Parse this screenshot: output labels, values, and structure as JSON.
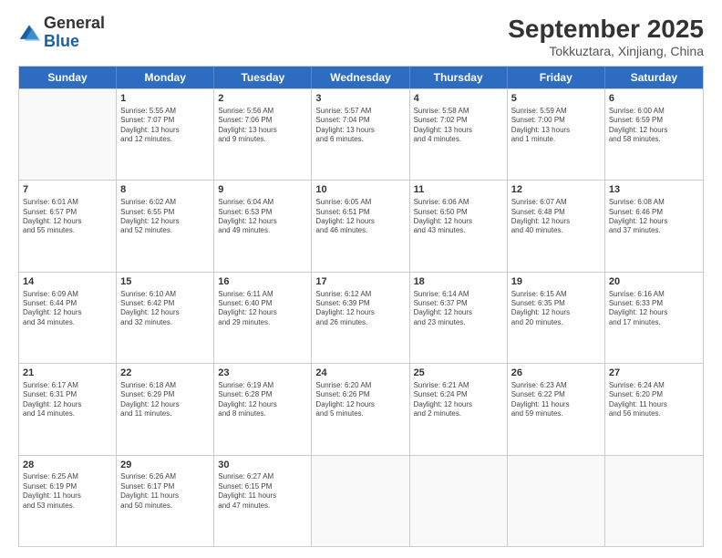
{
  "logo": {
    "general": "General",
    "blue": "Blue"
  },
  "header": {
    "month": "September 2025",
    "location": "Tokkuztara, Xinjiang, China"
  },
  "days": [
    "Sunday",
    "Monday",
    "Tuesday",
    "Wednesday",
    "Thursday",
    "Friday",
    "Saturday"
  ],
  "rows": [
    [
      {
        "day": "",
        "content": ""
      },
      {
        "day": "1",
        "content": "Sunrise: 5:55 AM\nSunset: 7:07 PM\nDaylight: 13 hours\nand 12 minutes."
      },
      {
        "day": "2",
        "content": "Sunrise: 5:56 AM\nSunset: 7:06 PM\nDaylight: 13 hours\nand 9 minutes."
      },
      {
        "day": "3",
        "content": "Sunrise: 5:57 AM\nSunset: 7:04 PM\nDaylight: 13 hours\nand 6 minutes."
      },
      {
        "day": "4",
        "content": "Sunrise: 5:58 AM\nSunset: 7:02 PM\nDaylight: 13 hours\nand 4 minutes."
      },
      {
        "day": "5",
        "content": "Sunrise: 5:59 AM\nSunset: 7:00 PM\nDaylight: 13 hours\nand 1 minute."
      },
      {
        "day": "6",
        "content": "Sunrise: 6:00 AM\nSunset: 6:59 PM\nDaylight: 12 hours\nand 58 minutes."
      }
    ],
    [
      {
        "day": "7",
        "content": "Sunrise: 6:01 AM\nSunset: 6:57 PM\nDaylight: 12 hours\nand 55 minutes."
      },
      {
        "day": "8",
        "content": "Sunrise: 6:02 AM\nSunset: 6:55 PM\nDaylight: 12 hours\nand 52 minutes."
      },
      {
        "day": "9",
        "content": "Sunrise: 6:04 AM\nSunset: 6:53 PM\nDaylight: 12 hours\nand 49 minutes."
      },
      {
        "day": "10",
        "content": "Sunrise: 6:05 AM\nSunset: 6:51 PM\nDaylight: 12 hours\nand 46 minutes."
      },
      {
        "day": "11",
        "content": "Sunrise: 6:06 AM\nSunset: 6:50 PM\nDaylight: 12 hours\nand 43 minutes."
      },
      {
        "day": "12",
        "content": "Sunrise: 6:07 AM\nSunset: 6:48 PM\nDaylight: 12 hours\nand 40 minutes."
      },
      {
        "day": "13",
        "content": "Sunrise: 6:08 AM\nSunset: 6:46 PM\nDaylight: 12 hours\nand 37 minutes."
      }
    ],
    [
      {
        "day": "14",
        "content": "Sunrise: 6:09 AM\nSunset: 6:44 PM\nDaylight: 12 hours\nand 34 minutes."
      },
      {
        "day": "15",
        "content": "Sunrise: 6:10 AM\nSunset: 6:42 PM\nDaylight: 12 hours\nand 32 minutes."
      },
      {
        "day": "16",
        "content": "Sunrise: 6:11 AM\nSunset: 6:40 PM\nDaylight: 12 hours\nand 29 minutes."
      },
      {
        "day": "17",
        "content": "Sunrise: 6:12 AM\nSunset: 6:39 PM\nDaylight: 12 hours\nand 26 minutes."
      },
      {
        "day": "18",
        "content": "Sunrise: 6:14 AM\nSunset: 6:37 PM\nDaylight: 12 hours\nand 23 minutes."
      },
      {
        "day": "19",
        "content": "Sunrise: 6:15 AM\nSunset: 6:35 PM\nDaylight: 12 hours\nand 20 minutes."
      },
      {
        "day": "20",
        "content": "Sunrise: 6:16 AM\nSunset: 6:33 PM\nDaylight: 12 hours\nand 17 minutes."
      }
    ],
    [
      {
        "day": "21",
        "content": "Sunrise: 6:17 AM\nSunset: 6:31 PM\nDaylight: 12 hours\nand 14 minutes."
      },
      {
        "day": "22",
        "content": "Sunrise: 6:18 AM\nSunset: 6:29 PM\nDaylight: 12 hours\nand 11 minutes."
      },
      {
        "day": "23",
        "content": "Sunrise: 6:19 AM\nSunset: 6:28 PM\nDaylight: 12 hours\nand 8 minutes."
      },
      {
        "day": "24",
        "content": "Sunrise: 6:20 AM\nSunset: 6:26 PM\nDaylight: 12 hours\nand 5 minutes."
      },
      {
        "day": "25",
        "content": "Sunrise: 6:21 AM\nSunset: 6:24 PM\nDaylight: 12 hours\nand 2 minutes."
      },
      {
        "day": "26",
        "content": "Sunrise: 6:23 AM\nSunset: 6:22 PM\nDaylight: 11 hours\nand 59 minutes."
      },
      {
        "day": "27",
        "content": "Sunrise: 6:24 AM\nSunset: 6:20 PM\nDaylight: 11 hours\nand 56 minutes."
      }
    ],
    [
      {
        "day": "28",
        "content": "Sunrise: 6:25 AM\nSunset: 6:19 PM\nDaylight: 11 hours\nand 53 minutes."
      },
      {
        "day": "29",
        "content": "Sunrise: 6:26 AM\nSunset: 6:17 PM\nDaylight: 11 hours\nand 50 minutes."
      },
      {
        "day": "30",
        "content": "Sunrise: 6:27 AM\nSunset: 6:15 PM\nDaylight: 11 hours\nand 47 minutes."
      },
      {
        "day": "",
        "content": ""
      },
      {
        "day": "",
        "content": ""
      },
      {
        "day": "",
        "content": ""
      },
      {
        "day": "",
        "content": ""
      }
    ]
  ]
}
